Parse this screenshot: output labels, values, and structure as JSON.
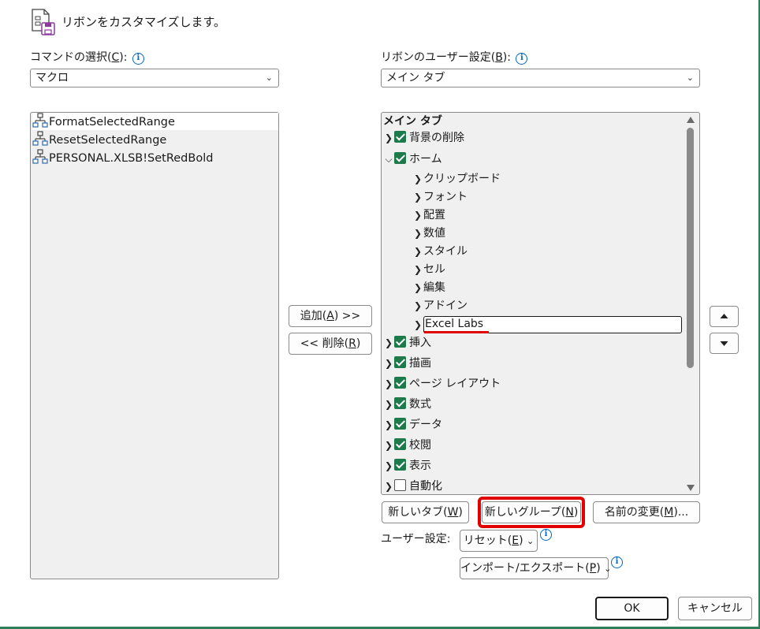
{
  "header": {
    "title": "リボンをカスタマイズします。",
    "icon": "customize-ribbon-icon"
  },
  "left": {
    "label": "コマンドの選択(C):",
    "label_prefix": "コマンドの選択(",
    "label_key": "C",
    "label_suffix": "):",
    "select_value": "マクロ",
    "items": [
      "FormatSelectedRange",
      "ResetSelectedRange",
      "PERSONAL.XLSB!SetRedBold"
    ]
  },
  "right": {
    "label_prefix": "リボンのユーザー設定(",
    "label_key": "B",
    "label_suffix": "):",
    "select_value": "メイン タブ",
    "tree_header": "メイン タブ",
    "tree": [
      {
        "label": "背景の削除",
        "level": 0,
        "checked": true,
        "expanded": false
      },
      {
        "label": "ホーム",
        "level": 0,
        "checked": true,
        "expanded": true
      },
      {
        "label": "クリップボード",
        "level": 1
      },
      {
        "label": "フォント",
        "level": 1
      },
      {
        "label": "配置",
        "level": 1
      },
      {
        "label": "数値",
        "level": 1
      },
      {
        "label": "スタイル",
        "level": 1
      },
      {
        "label": "セル",
        "level": 1
      },
      {
        "label": "編集",
        "level": 1
      },
      {
        "label": "アドイン",
        "level": 1
      },
      {
        "label": "Excel Labs",
        "level": 1,
        "editing": true
      },
      {
        "label": "挿入",
        "level": 0,
        "checked": true,
        "expanded": false
      },
      {
        "label": "描画",
        "level": 0,
        "checked": true,
        "expanded": false
      },
      {
        "label": "ページ レイアウト",
        "level": 0,
        "checked": true,
        "expanded": false
      },
      {
        "label": "数式",
        "level": 0,
        "checked": true,
        "expanded": false
      },
      {
        "label": "データ",
        "level": 0,
        "checked": true,
        "expanded": false
      },
      {
        "label": "校閲",
        "level": 0,
        "checked": true,
        "expanded": false
      },
      {
        "label": "表示",
        "level": 0,
        "checked": true,
        "expanded": false
      },
      {
        "label": "自動化",
        "level": 0,
        "checked": false,
        "expanded": false
      }
    ]
  },
  "buttons": {
    "add": {
      "prefix": "追加(",
      "key": "A",
      "suffix": ") >>"
    },
    "remove": {
      "prefix": "<< 削除(",
      "key": "R",
      "suffix": ")"
    },
    "new_tab": {
      "prefix": "新しいタブ(",
      "key": "W",
      "suffix": ")"
    },
    "new_group": {
      "prefix": "新しいグループ(",
      "key": "N",
      "suffix": ")"
    },
    "rename": {
      "prefix": "名前の変更(",
      "key": "M",
      "suffix": ")..."
    },
    "reset": {
      "prefix": "リセット(",
      "key": "E",
      "suffix": ")"
    },
    "import_export": {
      "prefix": "インポート/エクスポート(",
      "key": "P",
      "suffix": ")"
    },
    "ok": "OK",
    "cancel": "キャンセル"
  },
  "user_settings_label": "ユーザー設定:",
  "colors": {
    "checkbox": "#1e7a4a",
    "highlight": "#e00000",
    "info": "#0067c0"
  }
}
